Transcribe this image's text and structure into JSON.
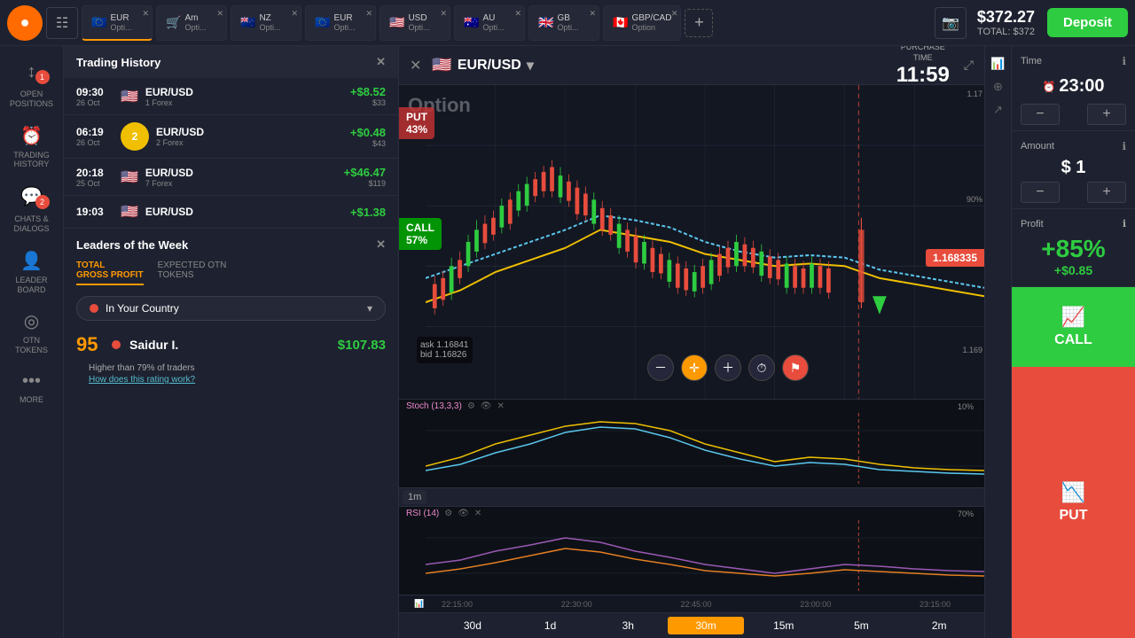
{
  "topbar": {
    "logo": "●",
    "balance": "$372.27",
    "balance_total": "TOTAL: $372",
    "deposit_label": "Deposit",
    "tabs": [
      {
        "flag": "🇪🇺",
        "label": "EUR",
        "sublabel": "Opti...",
        "active": true
      },
      {
        "flag": "🛒",
        "label": "Am",
        "sublabel": "Opti...",
        "active": false
      },
      {
        "flag": "🇳🇿",
        "label": "NZ",
        "sublabel": "Opti...",
        "active": false
      },
      {
        "flag": "🇪🇺",
        "label": "EUR",
        "sublabel": "Opti...",
        "active": false
      },
      {
        "flag": "🇺🇸",
        "label": "USD",
        "sublabel": "Opti...",
        "active": false
      },
      {
        "flag": "🇦🇺",
        "label": "AU",
        "sublabel": "Opti...",
        "active": false
      },
      {
        "flag": "🇬🇧",
        "label": "GB",
        "sublabel": "Opti...",
        "active": false
      },
      {
        "flag": "🇨🇦",
        "label": "GBP/CAD",
        "sublabel": "Option",
        "active": false
      }
    ]
  },
  "sidebar": {
    "items": [
      {
        "icon": "↕",
        "label": "OPEN\nPOSITIONS",
        "badge": "1"
      },
      {
        "icon": "⏰",
        "label": "TRADING\nHISTORY",
        "badge": null
      },
      {
        "icon": "💬",
        "label": "CHATS &\nDIALOGS",
        "badge": "2"
      },
      {
        "icon": "🏆",
        "label": "LEADER\nBOARD",
        "badge": null
      },
      {
        "icon": "◎",
        "label": "OTN\nTOKENS",
        "badge": null
      },
      {
        "icon": "•••",
        "label": "MORE",
        "badge": null
      }
    ]
  },
  "trading_history": {
    "title": "Trading History",
    "trades": [
      {
        "time": "09:30",
        "date": "26 Oct",
        "pair": "EUR/USD",
        "sub": "1 Forex",
        "profit": "+$8.52",
        "amount": "$33",
        "positive": true
      },
      {
        "time": "06:19",
        "date": "26 Oct",
        "pair": "EUR/USD",
        "sub": "2 Forex",
        "profit": "+$0.48",
        "amount": "$43",
        "positive": true
      },
      {
        "time": "20:18",
        "date": "25 Oct",
        "pair": "EUR/USD",
        "sub": "7 Forex",
        "profit": "+$46.47",
        "amount": "$119",
        "positive": true
      },
      {
        "time": "19:03",
        "date": "",
        "pair": "EUR/USD",
        "sub": "",
        "profit": "+$1.38",
        "amount": "",
        "positive": true
      }
    ]
  },
  "leaders": {
    "title": "Leaders of the Week",
    "tabs": [
      "TOTAL\nGROSS PROFIT",
      "EXPECTED OTN\nTOKENS"
    ],
    "country_label": "In Your Country",
    "leader": {
      "rank": "95",
      "name": "Saidur I.",
      "amount": "$107.83",
      "stat": "Higher than 79% of traders",
      "link": "How does this rating work?"
    }
  },
  "chart": {
    "pair": "EUR/USD",
    "purchase_time_label": "PURCHASE\nTIME",
    "purchase_time": "11:59",
    "option_label": "Option",
    "ask": "ask 1.16841",
    "bid": "bid 1.16826",
    "price": "1.168335",
    "put_pct": "43%",
    "call_pct": "57%",
    "time_periods": [
      "30d",
      "1d",
      "3h",
      "30m",
      "15m",
      "5m",
      "2m"
    ],
    "active_period": "30m",
    "stoch_label": "Stoch (13,3,3)",
    "rsi_label": "RSI (14)",
    "candle_time": "1m"
  },
  "right_panel": {
    "time_label": "Time",
    "time_value": "23:00",
    "amount_label": "Amount",
    "amount_value": "$ 1",
    "profit_label": "Profit",
    "profit_pct": "+85%",
    "profit_usd": "+$0.85",
    "call_label": "CALL",
    "put_label": "PUT"
  }
}
